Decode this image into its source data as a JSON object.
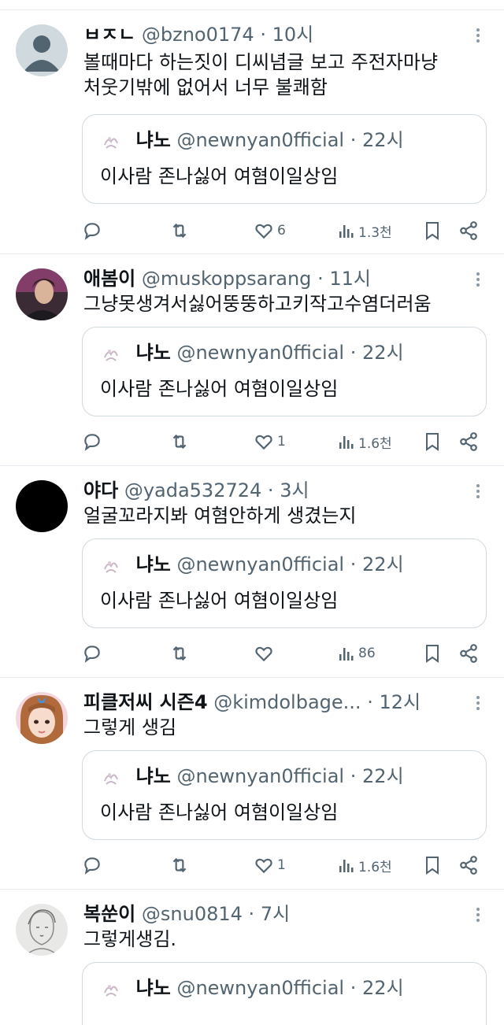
{
  "tweets": [
    {
      "display_name": "ㅂㅈㄴ",
      "handle": "@bzno0174",
      "time": "10시",
      "text_lines": [
        "볼때마다 하는짓이 디씨념글 보고 주전자마냥",
        "처웃기밖에 없어서 너무 불쾌함"
      ],
      "quote": {
        "display_name": "냐노",
        "handle": "@newnyan0fficial",
        "time": "22시",
        "text": "이사람 존나싫어 여혐이일상임"
      },
      "likes": "6",
      "views": "1.3천",
      "avatar": "default"
    },
    {
      "display_name": "애봄이",
      "handle": "@muskoppsarang",
      "time": "11시",
      "text_lines": [
        "그냥못생겨서싫어뚱뚱하고키작고수염더러움"
      ],
      "quote": {
        "display_name": "냐노",
        "handle": "@newnyan0fficial",
        "time": "22시",
        "text": "이사람 존나싫어 여혐이일상임"
      },
      "likes": "1",
      "views": "1.6천",
      "avatar": "photo-dark"
    },
    {
      "display_name": "야다",
      "handle": "@yada532724",
      "time": "3시",
      "text_lines": [
        "얼굴꼬라지봐 여혐안하게 생겼는지"
      ],
      "quote": {
        "display_name": "냐노",
        "handle": "@newnyan0fficial",
        "time": "22시",
        "text": "이사람 존나싫어 여혐이일상임"
      },
      "likes": "",
      "views": "86",
      "avatar": "black"
    },
    {
      "display_name": "피클저씨 시즌4",
      "handle": "@kimdolbage...",
      "time": "12시",
      "text_lines": [
        "그렇게 생김"
      ],
      "quote": {
        "display_name": "냐노",
        "handle": "@newnyan0fficial",
        "time": "22시",
        "text": "이사람 존나싫어 여혐이일상임"
      },
      "likes": "1",
      "views": "1.6천",
      "avatar": "photo-pink"
    },
    {
      "display_name": "복쑨이",
      "handle": "@snu0814",
      "time": "7시",
      "text_lines": [
        "그렇게생김."
      ],
      "quote": {
        "display_name": "냐노",
        "handle": "@newnyan0fficial",
        "time": "22시",
        "text": ""
      },
      "likes": "",
      "views": "",
      "avatar": "sketch"
    }
  ],
  "separator": "·",
  "icons": [
    "reply-icon",
    "retweet-icon",
    "like-icon",
    "views-icon",
    "bookmark-icon",
    "share-icon",
    "more-icon"
  ],
  "colors": {
    "text": "#0f1419",
    "secondary": "#536471",
    "border": "#cfd9de",
    "divider": "#e6ecf0"
  }
}
